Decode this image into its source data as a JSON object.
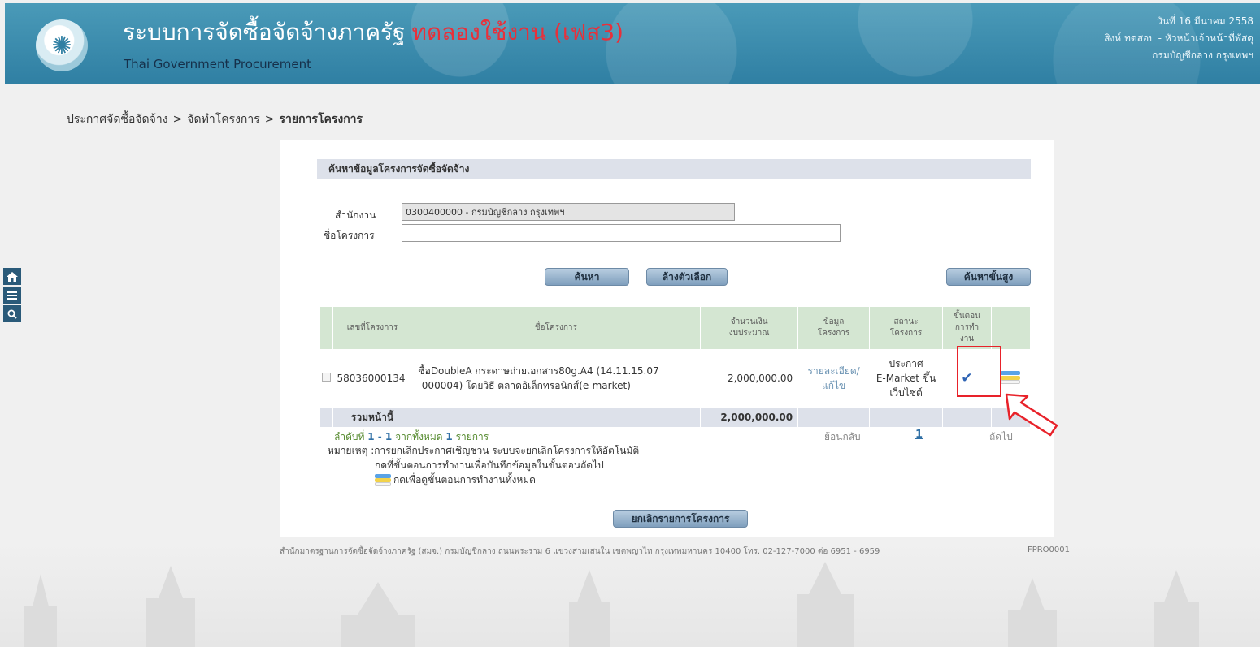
{
  "header": {
    "title": "ระบบการจัดซื้อจัดจ้างภาครัฐ",
    "trial_label": "ทดลองใช้งาน (เฟส3)",
    "subtitle": "Thai Government Procurement",
    "date": "วันที่ 16 มีนาคม 2558",
    "user": "สิงห์ ทดสอบ - หัวหน้าเจ้าหน้าที่พัสดุ",
    "department": "กรมบัญชีกลาง กรุงเทพฯ"
  },
  "breadcrumb": {
    "item1": "ประกาศจัดซื้อจัดจ้าง",
    "item2": "จัดทำโครงการ",
    "current": "รายการโครงการ",
    "separator": ">"
  },
  "side_icons": [
    "home-icon",
    "menu-icon",
    "search-icon"
  ],
  "search": {
    "title": "ค้นหาข้อมูลโครงการจัดซื้อจัดจ้าง",
    "office_label": "สำนักงาน",
    "office_value": "0300400000 - กรมบัญชีกลาง กรุงเทพฯ",
    "project_label": "ชื่อโครงการ",
    "project_value": "",
    "search_button": "ค้นหา",
    "clear_button": "ล้างตัวเลือก",
    "advanced_button": "ค้นหาขั้นสูง"
  },
  "table": {
    "headers": {
      "project_no": "เลขที่โครงการ",
      "project_name": "ชื่อโครงการ",
      "budget_line1": "จำนวนเงิน",
      "budget_line2": "งบประมาณ",
      "info_line1": "ข้อมูล",
      "info_line2": "โครงการ",
      "status_line1": "สถานะ",
      "status_line2": "โครงการ",
      "step_line1": "ขั้นตอน",
      "step_line2": "การทำ",
      "step_line3": "งาน"
    },
    "rows": [
      {
        "project_no": "58036000134",
        "project_name_line1": "ซื้อDoubleA กระดาษถ่ายเอกสาร80g.A4 (14.11.15.07",
        "project_name_line2": "-000004) โดยวิธี ตลาดอิเล็กทรอนิกส์(e-market)",
        "budget": "2,000,000.00",
        "info_link_line1": "รายละเอียด/",
        "info_link_line2": "แก้ไข",
        "status_line1": "ประกาศ",
        "status_line2": "E-Market ขึ้น",
        "status_line3": "เว็บไซต์"
      }
    ],
    "sum_label": "รวมหน้านี้",
    "sum_value": "2,000,000.00"
  },
  "pager": {
    "summary_prefix": "ลำดับที่",
    "range": "1 - 1",
    "from_all": "จากทั้งหมด",
    "total": "1",
    "items": "รายการ",
    "prev": "ย้อนกลับ",
    "page": "1",
    "next": "ถัดไป"
  },
  "notes": {
    "line1": "หมายเหตุ :การยกเลิกประกาศเชิญชวน ระบบจะยกเลิกโครงการให้อัตโนมัติ",
    "line2": "กดที่ขั้นตอนการทำงานเพื่อบันทึกข้อมูลในขั้นตอนถัดไป",
    "line3": "กดเพื่อดูขั้นตอนการทำงานทั้งหมด"
  },
  "cancel_button": "ยกเลิกรายการโครงการ",
  "footer": {
    "text": "สำนักมาตรฐานการจัดซื้อจัดจ้างภาครัฐ (สมจ.) กรมบัญชีกลาง ถนนพระราม 6 แขวงสามเสนใน เขตพญาไท กรุงเทพมหานคร 10400 โทร. 02-127-7000 ต่อ 6951 - 6959",
    "code": "FPRO0001"
  },
  "colors": {
    "header_bg": "#3a8cb0",
    "trial_red": "#e8303a",
    "table_header_bg": "#d4e6d2",
    "highlight": "#e8222a"
  }
}
